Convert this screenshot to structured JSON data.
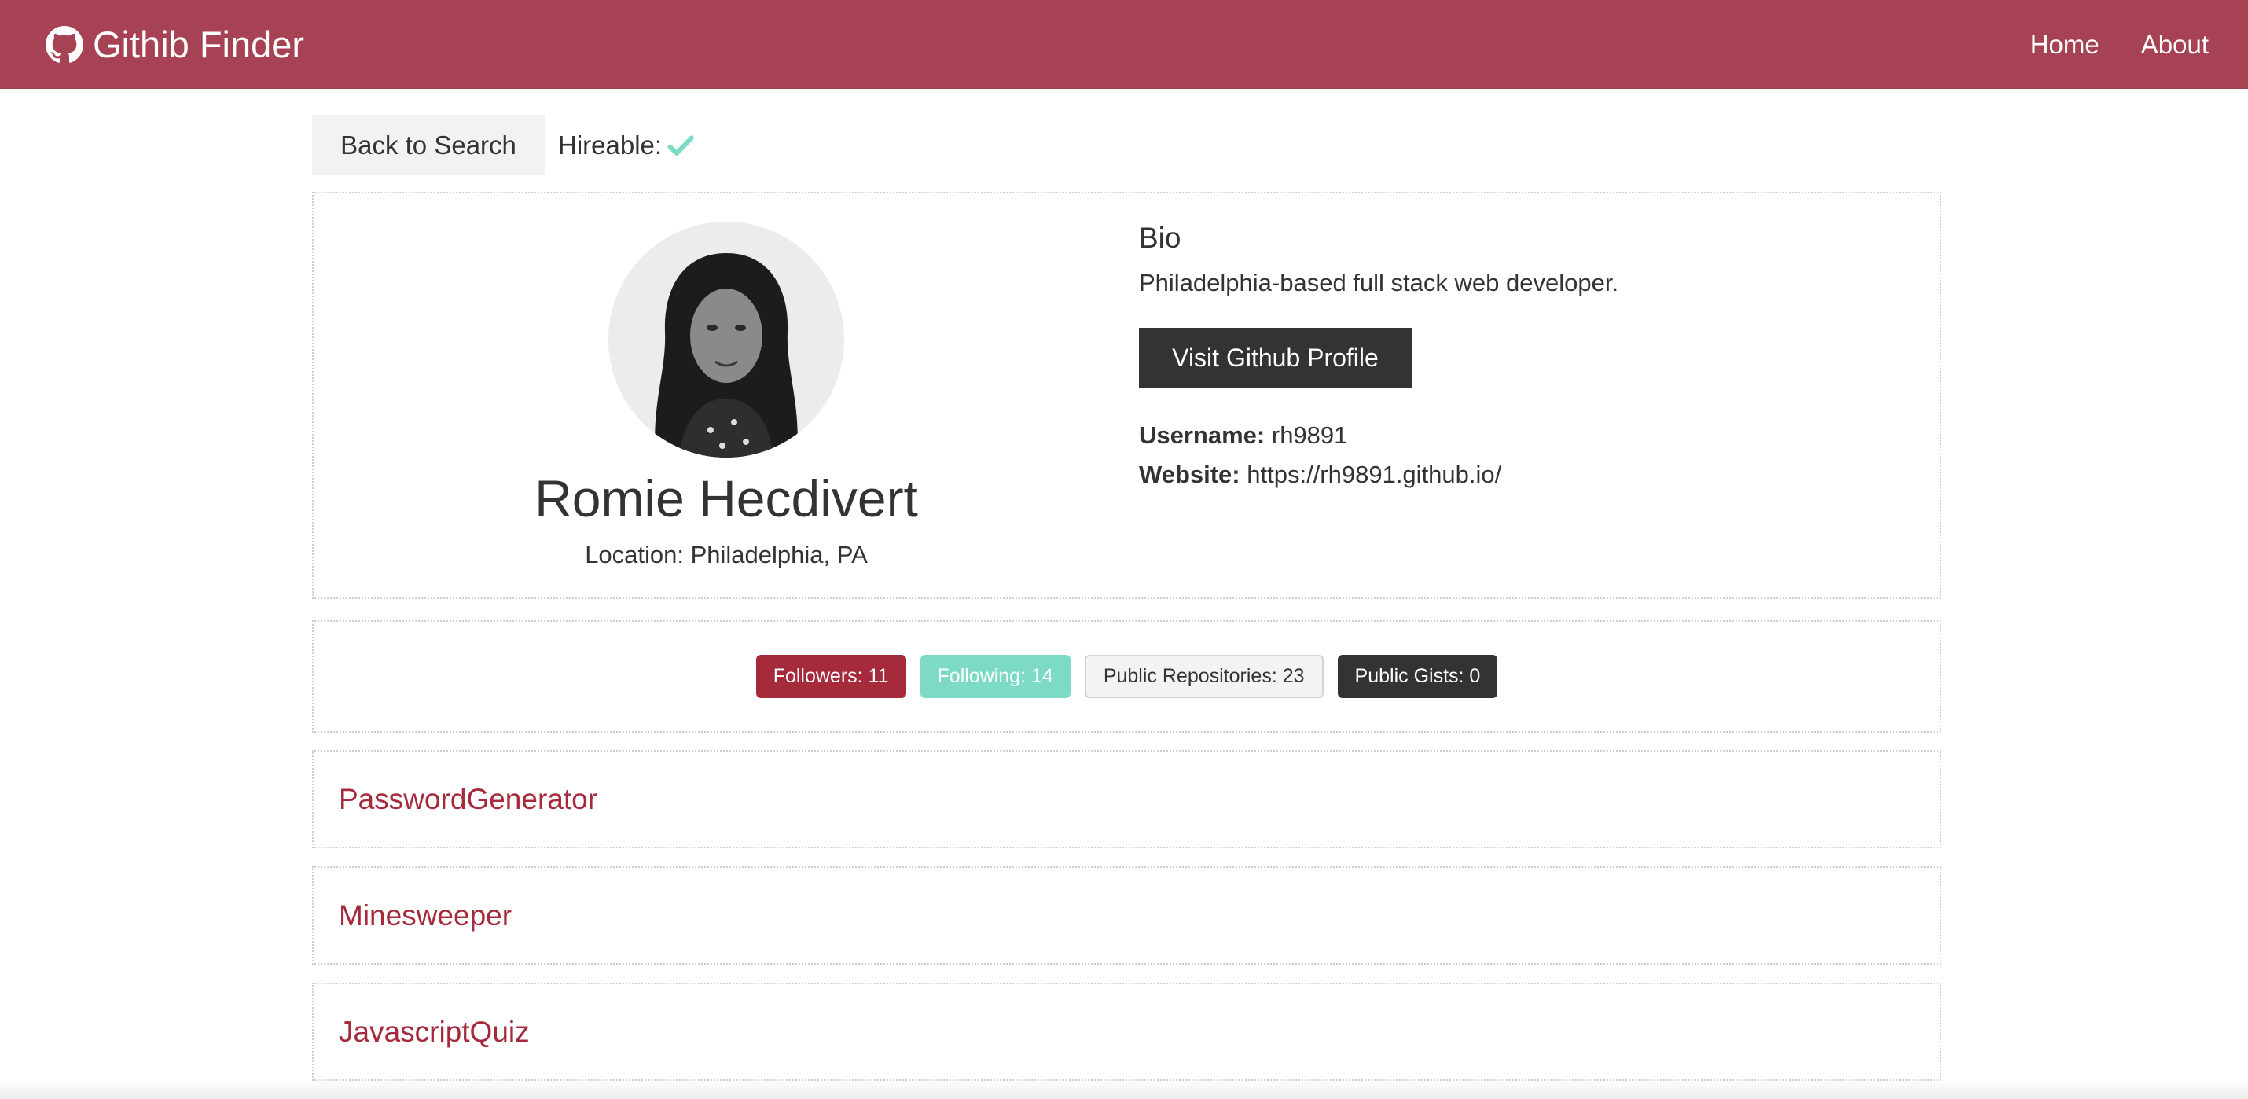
{
  "navbar": {
    "brand_icon": "github-icon",
    "brand_title": "Githib Finder",
    "links": [
      {
        "label": "Home"
      },
      {
        "label": "About"
      }
    ]
  },
  "actions": {
    "back_label": "Back to Search",
    "hireable_label": "Hireable:",
    "hireable_icon": "check-icon"
  },
  "profile": {
    "name": "Romie Hecdivert",
    "location": "Location: Philadelphia, PA",
    "bio_heading": "Bio",
    "bio": "Philadelphia-based full stack web developer.",
    "visit_label": "Visit Github Profile",
    "username_label": "Username:",
    "username": "rh9891",
    "website_label": "Website:",
    "website": "https://rh9891.github.io/"
  },
  "stats": {
    "followers": "Followers: 11",
    "following": "Following: 14",
    "repos": "Public Repositories: 23",
    "gists": "Public Gists: 0"
  },
  "repos": [
    {
      "name": "PasswordGenerator"
    },
    {
      "name": "Minesweeper"
    },
    {
      "name": "JavascriptQuiz"
    }
  ],
  "colors": {
    "primary": "#a64253",
    "danger": "#a52a3c",
    "success": "#7ddbc5",
    "dark": "#333333",
    "light": "#f2f2f2"
  }
}
